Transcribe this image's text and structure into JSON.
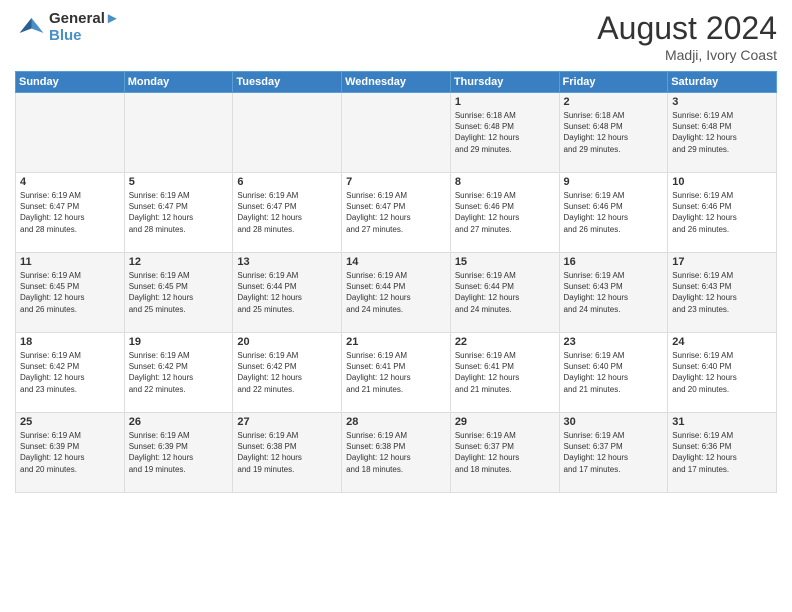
{
  "header": {
    "logo_line1": "General",
    "logo_line2": "Blue",
    "month_year": "August 2024",
    "location": "Madji, Ivory Coast"
  },
  "weekdays": [
    "Sunday",
    "Monday",
    "Tuesday",
    "Wednesday",
    "Thursday",
    "Friday",
    "Saturday"
  ],
  "weeks": [
    [
      {
        "day": "",
        "detail": ""
      },
      {
        "day": "",
        "detail": ""
      },
      {
        "day": "",
        "detail": ""
      },
      {
        "day": "",
        "detail": ""
      },
      {
        "day": "1",
        "detail": "Sunrise: 6:18 AM\nSunset: 6:48 PM\nDaylight: 12 hours\nand 29 minutes."
      },
      {
        "day": "2",
        "detail": "Sunrise: 6:18 AM\nSunset: 6:48 PM\nDaylight: 12 hours\nand 29 minutes."
      },
      {
        "day": "3",
        "detail": "Sunrise: 6:19 AM\nSunset: 6:48 PM\nDaylight: 12 hours\nand 29 minutes."
      }
    ],
    [
      {
        "day": "4",
        "detail": "Sunrise: 6:19 AM\nSunset: 6:47 PM\nDaylight: 12 hours\nand 28 minutes."
      },
      {
        "day": "5",
        "detail": "Sunrise: 6:19 AM\nSunset: 6:47 PM\nDaylight: 12 hours\nand 28 minutes."
      },
      {
        "day": "6",
        "detail": "Sunrise: 6:19 AM\nSunset: 6:47 PM\nDaylight: 12 hours\nand 28 minutes."
      },
      {
        "day": "7",
        "detail": "Sunrise: 6:19 AM\nSunset: 6:47 PM\nDaylight: 12 hours\nand 27 minutes."
      },
      {
        "day": "8",
        "detail": "Sunrise: 6:19 AM\nSunset: 6:46 PM\nDaylight: 12 hours\nand 27 minutes."
      },
      {
        "day": "9",
        "detail": "Sunrise: 6:19 AM\nSunset: 6:46 PM\nDaylight: 12 hours\nand 26 minutes."
      },
      {
        "day": "10",
        "detail": "Sunrise: 6:19 AM\nSunset: 6:46 PM\nDaylight: 12 hours\nand 26 minutes."
      }
    ],
    [
      {
        "day": "11",
        "detail": "Sunrise: 6:19 AM\nSunset: 6:45 PM\nDaylight: 12 hours\nand 26 minutes."
      },
      {
        "day": "12",
        "detail": "Sunrise: 6:19 AM\nSunset: 6:45 PM\nDaylight: 12 hours\nand 25 minutes."
      },
      {
        "day": "13",
        "detail": "Sunrise: 6:19 AM\nSunset: 6:44 PM\nDaylight: 12 hours\nand 25 minutes."
      },
      {
        "day": "14",
        "detail": "Sunrise: 6:19 AM\nSunset: 6:44 PM\nDaylight: 12 hours\nand 24 minutes."
      },
      {
        "day": "15",
        "detail": "Sunrise: 6:19 AM\nSunset: 6:44 PM\nDaylight: 12 hours\nand 24 minutes."
      },
      {
        "day": "16",
        "detail": "Sunrise: 6:19 AM\nSunset: 6:43 PM\nDaylight: 12 hours\nand 24 minutes."
      },
      {
        "day": "17",
        "detail": "Sunrise: 6:19 AM\nSunset: 6:43 PM\nDaylight: 12 hours\nand 23 minutes."
      }
    ],
    [
      {
        "day": "18",
        "detail": "Sunrise: 6:19 AM\nSunset: 6:42 PM\nDaylight: 12 hours\nand 23 minutes."
      },
      {
        "day": "19",
        "detail": "Sunrise: 6:19 AM\nSunset: 6:42 PM\nDaylight: 12 hours\nand 22 minutes."
      },
      {
        "day": "20",
        "detail": "Sunrise: 6:19 AM\nSunset: 6:42 PM\nDaylight: 12 hours\nand 22 minutes."
      },
      {
        "day": "21",
        "detail": "Sunrise: 6:19 AM\nSunset: 6:41 PM\nDaylight: 12 hours\nand 21 minutes."
      },
      {
        "day": "22",
        "detail": "Sunrise: 6:19 AM\nSunset: 6:41 PM\nDaylight: 12 hours\nand 21 minutes."
      },
      {
        "day": "23",
        "detail": "Sunrise: 6:19 AM\nSunset: 6:40 PM\nDaylight: 12 hours\nand 21 minutes."
      },
      {
        "day": "24",
        "detail": "Sunrise: 6:19 AM\nSunset: 6:40 PM\nDaylight: 12 hours\nand 20 minutes."
      }
    ],
    [
      {
        "day": "25",
        "detail": "Sunrise: 6:19 AM\nSunset: 6:39 PM\nDaylight: 12 hours\nand 20 minutes."
      },
      {
        "day": "26",
        "detail": "Sunrise: 6:19 AM\nSunset: 6:39 PM\nDaylight: 12 hours\nand 19 minutes."
      },
      {
        "day": "27",
        "detail": "Sunrise: 6:19 AM\nSunset: 6:38 PM\nDaylight: 12 hours\nand 19 minutes."
      },
      {
        "day": "28",
        "detail": "Sunrise: 6:19 AM\nSunset: 6:38 PM\nDaylight: 12 hours\nand 18 minutes."
      },
      {
        "day": "29",
        "detail": "Sunrise: 6:19 AM\nSunset: 6:37 PM\nDaylight: 12 hours\nand 18 minutes."
      },
      {
        "day": "30",
        "detail": "Sunrise: 6:19 AM\nSunset: 6:37 PM\nDaylight: 12 hours\nand 17 minutes."
      },
      {
        "day": "31",
        "detail": "Sunrise: 6:19 AM\nSunset: 6:36 PM\nDaylight: 12 hours\nand 17 minutes."
      }
    ]
  ]
}
